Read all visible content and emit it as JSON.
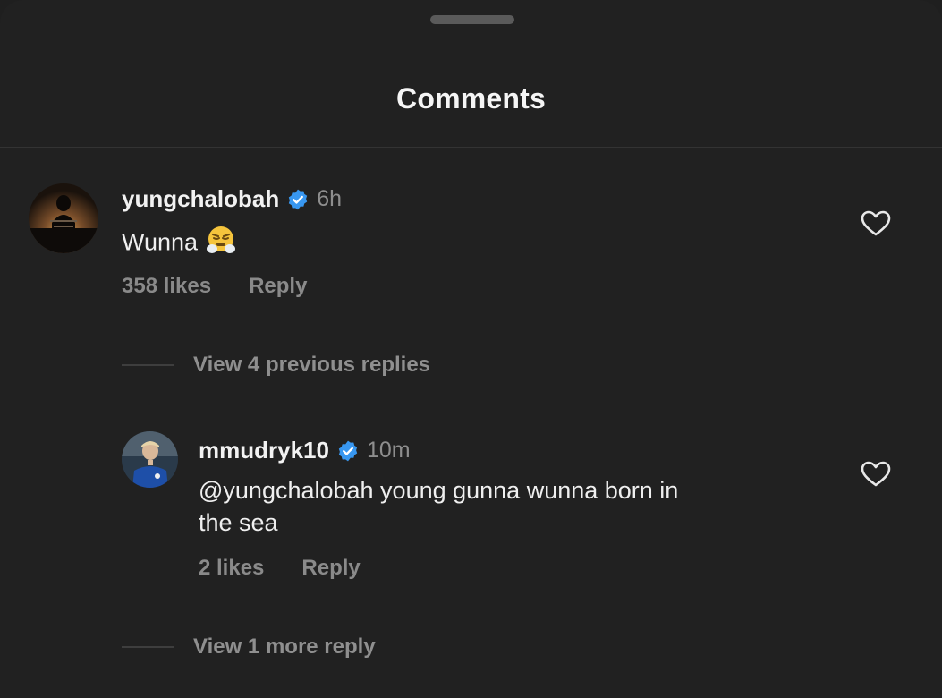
{
  "sheet": {
    "title": "Comments"
  },
  "comments": [
    {
      "username": "yungchalobah",
      "verified": true,
      "time": "6h",
      "text": "Wunna",
      "emoji": "steam-from-nose-emoji",
      "likes": "358 likes",
      "reply_label": "Reply",
      "view_replies": "View 4 previous replies"
    },
    {
      "username": "mmudryk10",
      "verified": true,
      "time": "10m",
      "text_line1": "@yungchalobah young gunna wunna born in",
      "text_line2": "the sea",
      "likes": "2 likes",
      "reply_label": "Reply",
      "view_replies": "View 1 more reply"
    }
  ],
  "icons": {
    "verified": "verified-badge-icon",
    "like": "heart-outline-icon"
  },
  "colors": {
    "background": "#212121",
    "verified": "#3897f0",
    "muted_text": "#8e8e8e"
  }
}
